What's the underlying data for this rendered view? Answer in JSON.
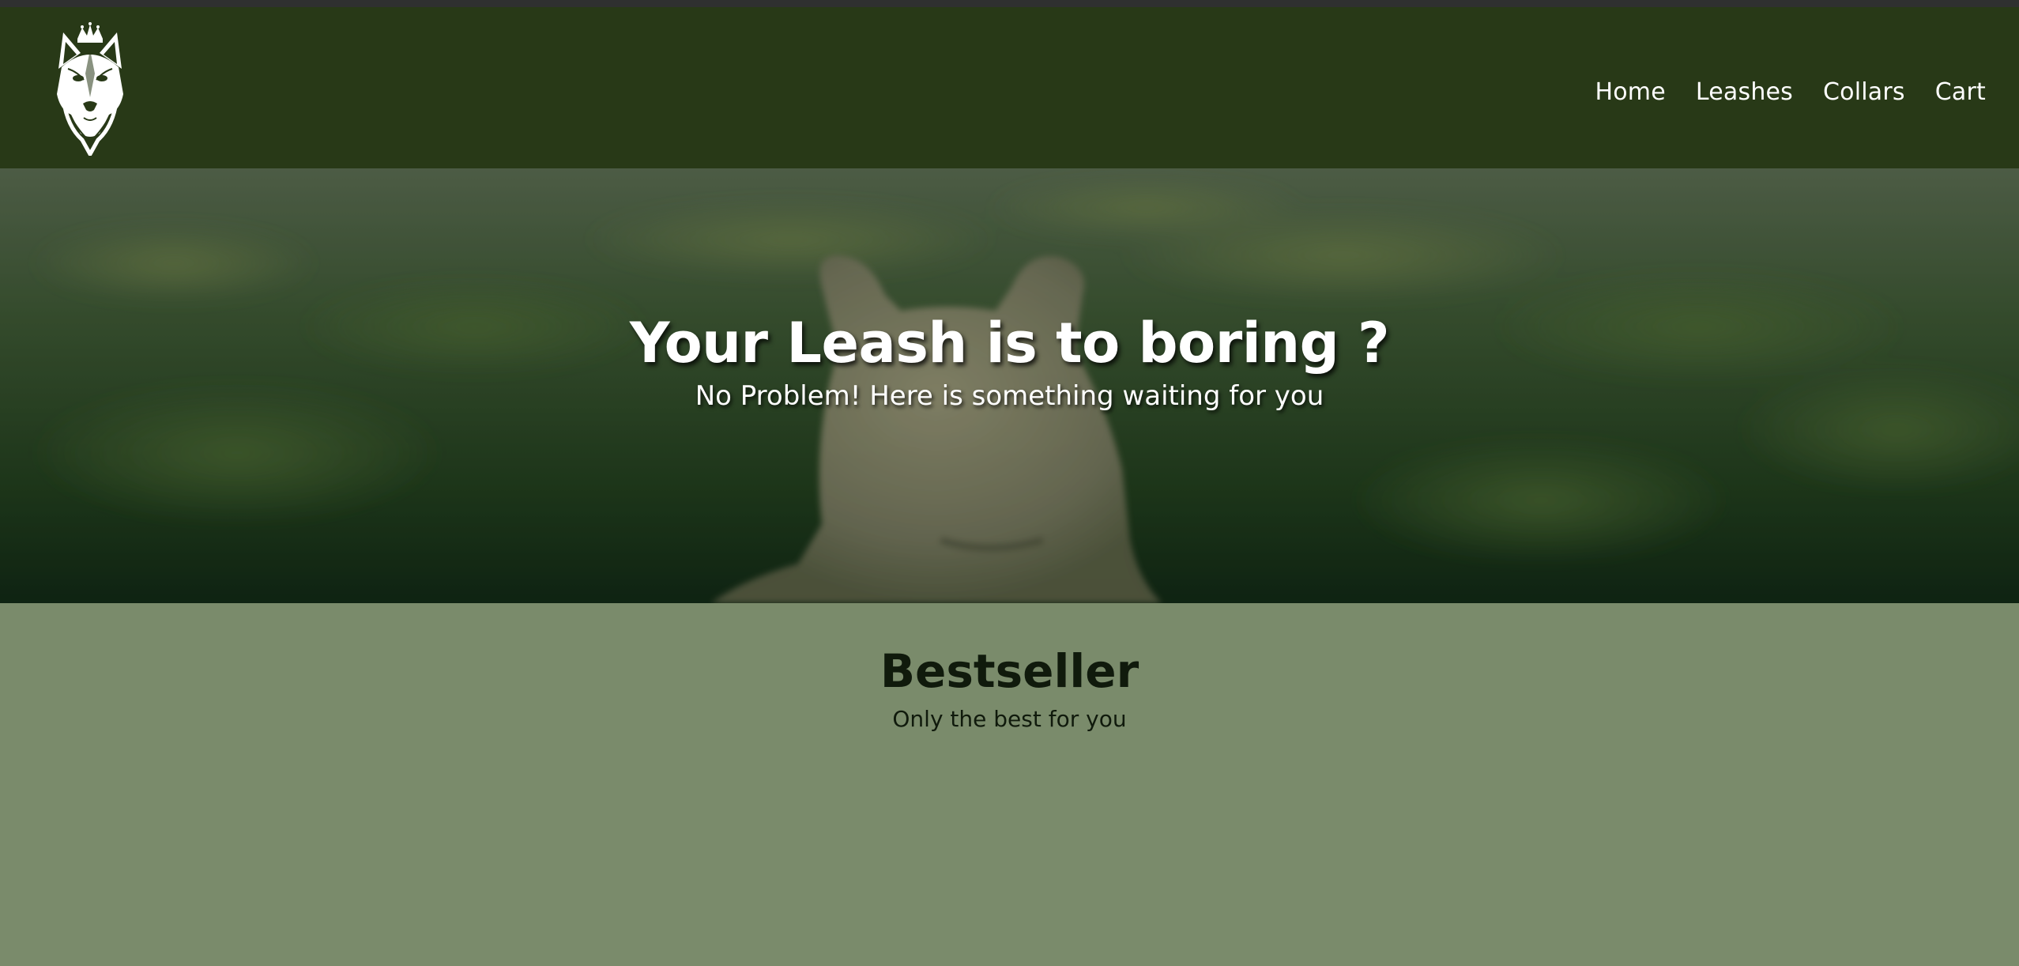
{
  "header": {
    "logo_icon": "crowned-dog-head-logo",
    "background_color": "#283917"
  },
  "nav": {
    "items": [
      {
        "label": "Home"
      },
      {
        "label": "Leashes"
      },
      {
        "label": "Collars"
      },
      {
        "label": "Cart"
      }
    ],
    "text_color": "#ffffff"
  },
  "hero": {
    "title": "Your Leash is to boring ?",
    "subtitle": "No Problem! Here is something waiting for you",
    "image": "dog-in-green-field-photo"
  },
  "bestseller": {
    "title": "Bestseller",
    "subtitle": "Only the best for you",
    "background_color": "#7a8b6b"
  }
}
